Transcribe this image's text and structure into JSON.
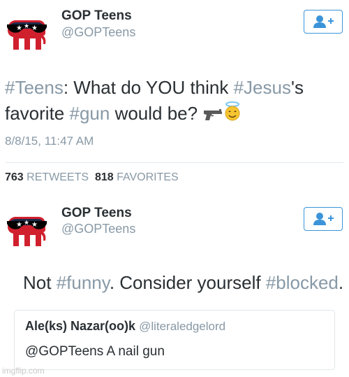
{
  "tweet1": {
    "name": "GOP Teens",
    "handle": "@GOPTeens",
    "text_parts": {
      "h1": "#Teens",
      "t1": ": What do YOU think ",
      "h2": "#Jesus",
      "t2": "'s",
      "t3": "favorite ",
      "h3": "#gun",
      "t4": " would be? "
    },
    "timestamp": "8/8/15, 11:47 AM",
    "retweets_count": "763",
    "retweets_label": "RETWEETS",
    "favorites_count": "818",
    "favorites_label": "FAVORITES"
  },
  "tweet2": {
    "name": "GOP Teens",
    "handle": "@GOPTeens",
    "text_parts": {
      "t1": "Not ",
      "h1": "#funny",
      "t2": ". Consider yourself ",
      "h2": "#blocked",
      "t3": "."
    }
  },
  "quote": {
    "name": "Ale(ks) Nazar(oo)k",
    "handle": "@literaledgelord",
    "text": "@GOPTeens A nail gun"
  },
  "watermark": "imgflip.com",
  "icons": [
    "gop-elephant-avatar-icon",
    "follow-user-icon",
    "pistol-emoji-icon",
    "angel-emoji-icon"
  ],
  "colors": {
    "accent": "#3b94d9",
    "hashtag": "#8899a6",
    "red": "#d0202e",
    "navy": "#1c2a4a"
  }
}
